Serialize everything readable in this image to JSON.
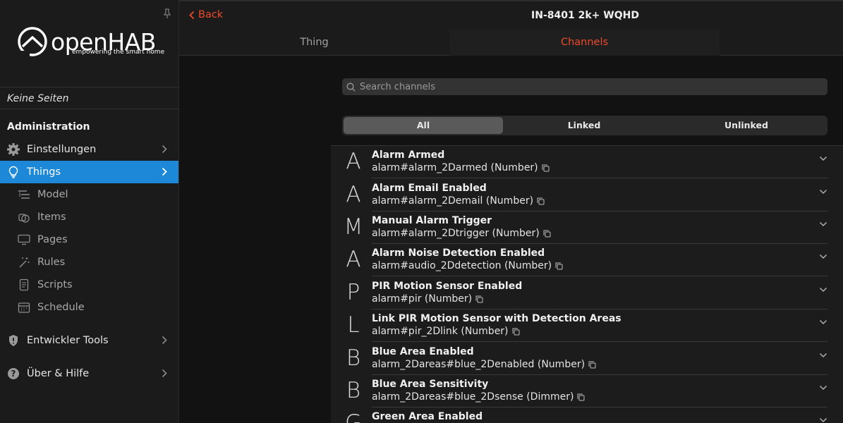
{
  "sidebar": {
    "logo_text": "openHAB",
    "logo_tagline": "empowering the smart home",
    "no_pages": "Keine Seiten",
    "admin_title": "Administration",
    "settings": "Einstellungen",
    "things": "Things",
    "model": "Model",
    "items": "Items",
    "pages": "Pages",
    "rules": "Rules",
    "scripts": "Scripts",
    "schedule": "Schedule",
    "dev_tools": "Entwickler Tools",
    "about": "Über & Hilfe"
  },
  "topbar": {
    "back": "Back",
    "title": "IN-8401 2k+ WQHD"
  },
  "tabs": {
    "thing": "Thing",
    "channels": "Channels"
  },
  "search": {
    "placeholder": "Search channels"
  },
  "filter": {
    "all": "All",
    "linked": "Linked",
    "unlinked": "Unlinked"
  },
  "channels": [
    {
      "letter": "A",
      "name": "Alarm Armed",
      "uid": "alarm#alarm_2Darmed (Number)"
    },
    {
      "letter": "A",
      "name": "Alarm Email Enabled",
      "uid": "alarm#alarm_2Demail (Number)"
    },
    {
      "letter": "M",
      "name": "Manual Alarm Trigger",
      "uid": "alarm#alarm_2Dtrigger (Number)"
    },
    {
      "letter": "A",
      "name": "Alarm Noise Detection Enabled",
      "uid": "alarm#audio_2Ddetection (Number)"
    },
    {
      "letter": "P",
      "name": "PIR Motion Sensor Enabled",
      "uid": "alarm#pir (Number)"
    },
    {
      "letter": "L",
      "name": "Link PIR Motion Sensor with Detection Areas",
      "uid": "alarm#pir_2Dlink (Number)"
    },
    {
      "letter": "B",
      "name": "Blue Area Enabled",
      "uid": "alarm_2Dareas#blue_2Denabled (Number)"
    },
    {
      "letter": "B",
      "name": "Blue Area Sensitivity",
      "uid": "alarm_2Dareas#blue_2Dsense (Dimmer)"
    },
    {
      "letter": "G",
      "name": "Green Area Enabled",
      "uid": ""
    }
  ],
  "colors": {
    "accent": "#ee4a2a",
    "active_nav": "#1e88d8"
  }
}
